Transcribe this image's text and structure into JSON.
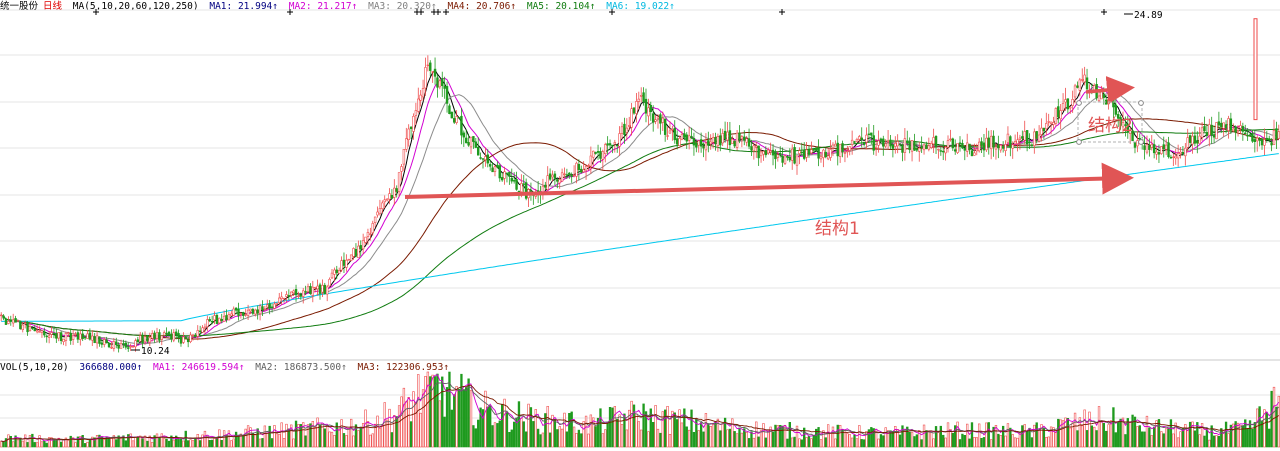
{
  "price_legend": {
    "stock_name": "统一股份",
    "period": "日线",
    "ma_params": "MA(5,10,20,60,120,250)",
    "ma1": "MA1: 21.994↑",
    "ma2": "MA2: 21.217↑",
    "ma3": "MA3: 20.320↑",
    "ma4": "MA4: 20.706↑",
    "ma5": "MA5: 20.104↑",
    "ma6": "MA6: 19.022↑"
  },
  "volume_legend": {
    "params": "VOL(5,10,20)",
    "vol": "366680.000↑",
    "ma1": "MA1: 246619.594↑",
    "ma2": "MA2: 186873.500↑",
    "ma3": "MA3: 122306.953↑"
  },
  "colors": {
    "up": "#ef4a4a",
    "down": "#1e9a1e",
    "ma1": "#000000",
    "ma2": "#d200d2",
    "ma3": "#8c8c8c",
    "ma4": "#7a1a00",
    "ma5": "#107c10",
    "ma6": "#00c8ee",
    "annotation": "#e05555",
    "grid": "#e6e6e6"
  },
  "annotations": {
    "structure1": "结构1",
    "structure2": "结构2",
    "high_label": "24.89",
    "low_label": "10.24"
  },
  "chart_data": {
    "type": "candlestick",
    "title": "统一股份 日线",
    "price_range": [
      10.0,
      25.3
    ],
    "grid": true,
    "price_high": 24.89,
    "price_low": 10.24,
    "moving_averages": [
      5,
      10,
      20,
      60,
      120,
      250
    ],
    "volume_moving_averages": [
      5,
      10,
      20
    ],
    "last_volume": 366680.0,
    "series": [
      {
        "name": "MA1",
        "value": 21.994
      },
      {
        "name": "MA2",
        "value": 21.217
      },
      {
        "name": "MA3",
        "value": 20.32
      },
      {
        "name": "MA4",
        "value": 20.706
      },
      {
        "name": "MA5",
        "value": 20.104
      },
      {
        "name": "MA6",
        "value": 19.022
      }
    ],
    "volume_series": [
      {
        "name": "MA1",
        "value": 246619.594
      },
      {
        "name": "MA2",
        "value": 186873.5
      },
      {
        "name": "MA3",
        "value": 122306.953
      }
    ],
    "price_path": [
      [
        0,
        11.6
      ],
      [
        12,
        11.2
      ],
      [
        25,
        10.8
      ],
      [
        35,
        10.9
      ],
      [
        45,
        10.5
      ],
      [
        52,
        10.3
      ],
      [
        58,
        10.7
      ],
      [
        70,
        10.9
      ],
      [
        78,
        10.6
      ],
      [
        85,
        11.4
      ],
      [
        95,
        11.8
      ],
      [
        110,
        12.1
      ],
      [
        122,
        12.8
      ],
      [
        135,
        12.9
      ],
      [
        140,
        13.8
      ],
      [
        148,
        14.6
      ],
      [
        157,
        16.2
      ],
      [
        165,
        17.6
      ],
      [
        172,
        20.8
      ],
      [
        178,
        23.0
      ],
      [
        185,
        21.5
      ],
      [
        195,
        19.5
      ],
      [
        205,
        18.4
      ],
      [
        215,
        17.6
      ],
      [
        222,
        17.0
      ],
      [
        228,
        17.7
      ],
      [
        238,
        18.1
      ],
      [
        250,
        19.0
      ],
      [
        258,
        19.6
      ],
      [
        266,
        21.4
      ],
      [
        272,
        20.7
      ],
      [
        282,
        19.6
      ],
      [
        292,
        19.4
      ],
      [
        305,
        19.7
      ],
      [
        318,
        19.0
      ],
      [
        335,
        18.8
      ],
      [
        350,
        19.2
      ],
      [
        362,
        19.5
      ],
      [
        375,
        19.3
      ],
      [
        390,
        19.4
      ],
      [
        405,
        19.2
      ],
      [
        420,
        19.6
      ],
      [
        432,
        19.7
      ],
      [
        442,
        21.0
      ],
      [
        452,
        22.1
      ],
      [
        458,
        21.6
      ],
      [
        465,
        20.8
      ],
      [
        473,
        19.5
      ],
      [
        482,
        19.1
      ],
      [
        490,
        19.1
      ],
      [
        498,
        19.7
      ],
      [
        512,
        20.3
      ],
      [
        520,
        19.8
      ],
      [
        528,
        19.6
      ],
      [
        533,
        19.9
      ]
    ],
    "volume_path": [
      [
        0,
        0.12
      ],
      [
        30,
        0.1
      ],
      [
        60,
        0.13
      ],
      [
        90,
        0.16
      ],
      [
        120,
        0.22
      ],
      [
        150,
        0.3
      ],
      [
        165,
        0.45
      ],
      [
        175,
        0.72
      ],
      [
        185,
        0.78
      ],
      [
        200,
        0.5
      ],
      [
        220,
        0.38
      ],
      [
        245,
        0.3
      ],
      [
        265,
        0.42
      ],
      [
        285,
        0.34
      ],
      [
        310,
        0.24
      ],
      [
        340,
        0.2
      ],
      [
        370,
        0.18
      ],
      [
        400,
        0.22
      ],
      [
        430,
        0.2
      ],
      [
        445,
        0.3
      ],
      [
        460,
        0.36
      ],
      [
        480,
        0.26
      ],
      [
        505,
        0.2
      ],
      [
        520,
        0.24
      ],
      [
        533,
        0.62
      ]
    ]
  }
}
